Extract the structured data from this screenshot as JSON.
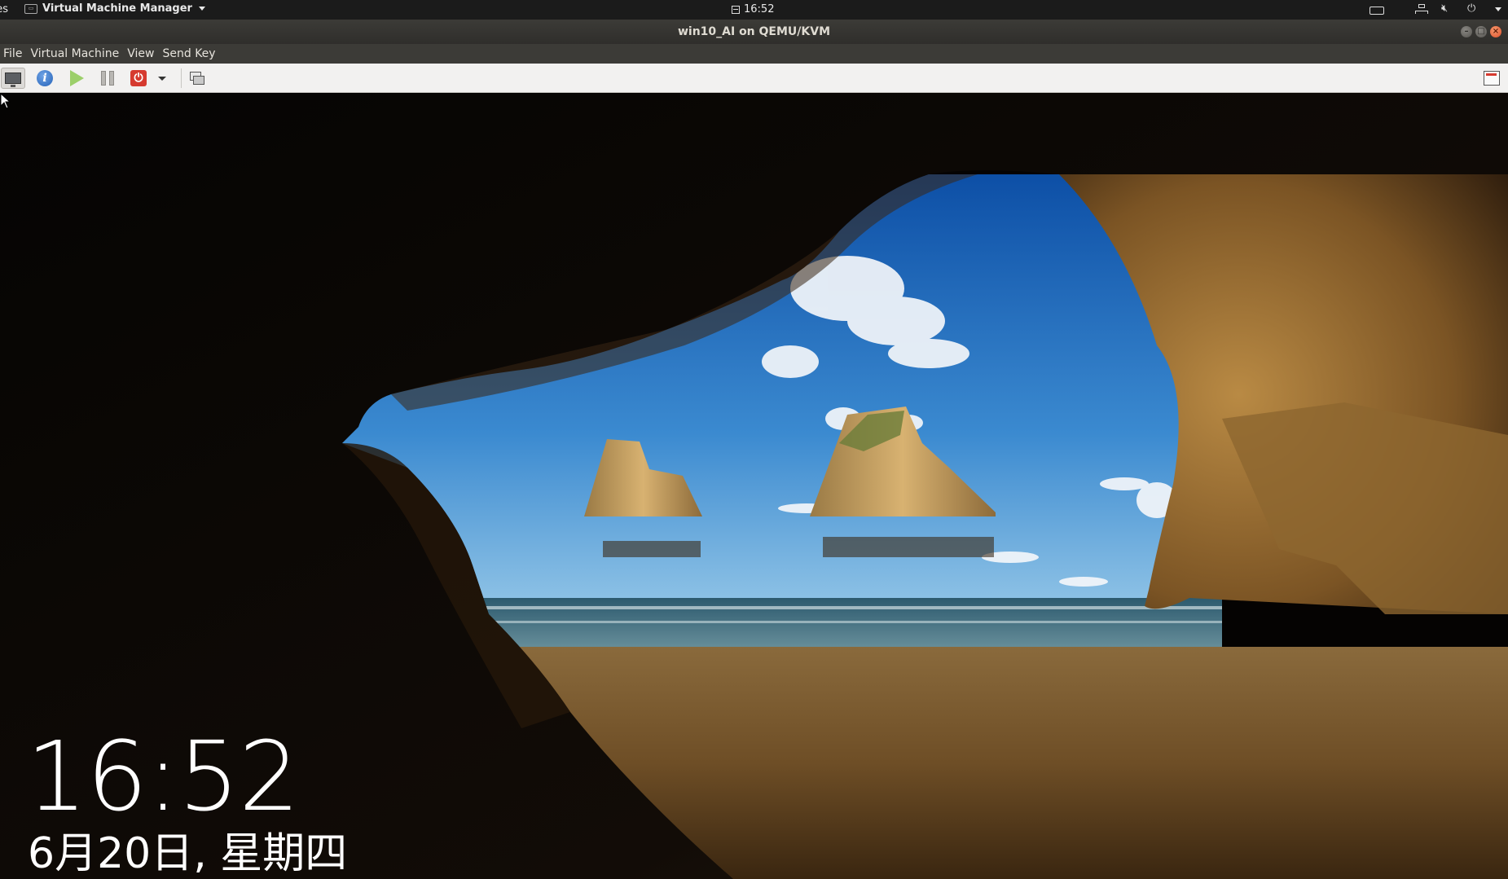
{
  "topbar": {
    "activities_label": "Activities",
    "app_name": "Virtual Machine Manager",
    "clock": "16:52"
  },
  "window": {
    "title": "win10_AI on QEMU/KVM"
  },
  "menu": {
    "file": "File",
    "virtual_machine": "Virtual Machine",
    "view": "View",
    "send_key": "Send Key"
  },
  "toolbar": {
    "console_icon": "monitor-icon",
    "details_icon": "info-icon",
    "run_icon": "play-icon",
    "pause_icon": "pause-icon",
    "shutdown_icon": "power-icon",
    "shutdown_menu_icon": "caret-down-icon",
    "snapshots_icon": "snapshots-icon",
    "fullscreen_icon": "fullscreen-icon"
  },
  "guest": {
    "lock_time": "16:52",
    "lock_date": "6月20日, 星期四"
  },
  "colors": {
    "topbar_bg": "#1b1b1b",
    "titlebar_bg": "#3c3b37",
    "toolbar_bg": "#f2f1f0",
    "close_button": "#e0502b"
  }
}
